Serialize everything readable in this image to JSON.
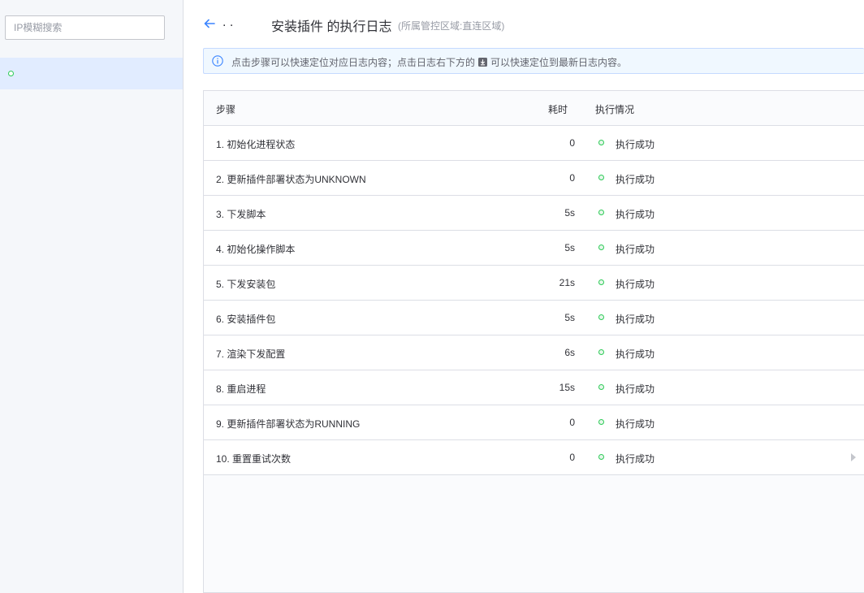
{
  "sidebar": {
    "search_placeholder": "IP模糊搜索",
    "hosts": [
      {
        "label": ""
      }
    ]
  },
  "header": {
    "host_ip": ". .",
    "title": "安装插件 的执行日志",
    "subtitle": "(所属管控区域:直连区域)"
  },
  "info": {
    "text_before": "点击步骤可以快速定位对应日志内容；点击日志右下方的",
    "text_after": "可以快速定位到最新日志内容。"
  },
  "table": {
    "columns": {
      "step": "步骤",
      "time": "耗时",
      "status": "执行情况"
    },
    "rows": [
      {
        "step": "1. 初始化进程状态",
        "time": "0",
        "status": "执行成功"
      },
      {
        "step": "2. 更新插件部署状态为UNKNOWN",
        "time": "0",
        "status": "执行成功"
      },
      {
        "step": "3. 下发脚本",
        "time": "5s",
        "status": "执行成功"
      },
      {
        "step": "4. 初始化操作脚本",
        "time": "5s",
        "status": "执行成功"
      },
      {
        "step": "5. 下发安装包",
        "time": "21s",
        "status": "执行成功"
      },
      {
        "step": "6. 安装插件包",
        "time": "5s",
        "status": "执行成功"
      },
      {
        "step": "7. 渲染下发配置",
        "time": "6s",
        "status": "执行成功"
      },
      {
        "step": "8. 重启进程",
        "time": "15s",
        "status": "执行成功"
      },
      {
        "step": "9. 更新插件部署状态为RUNNING",
        "time": "0",
        "status": "执行成功"
      },
      {
        "step": "10. 重置重试次数",
        "time": "0",
        "status": "执行成功"
      }
    ]
  },
  "colors": {
    "accent": "#3a84ff",
    "success": "#2dcb56",
    "selected_bg": "#e1ecff",
    "info_bg": "#f0f8ff"
  }
}
